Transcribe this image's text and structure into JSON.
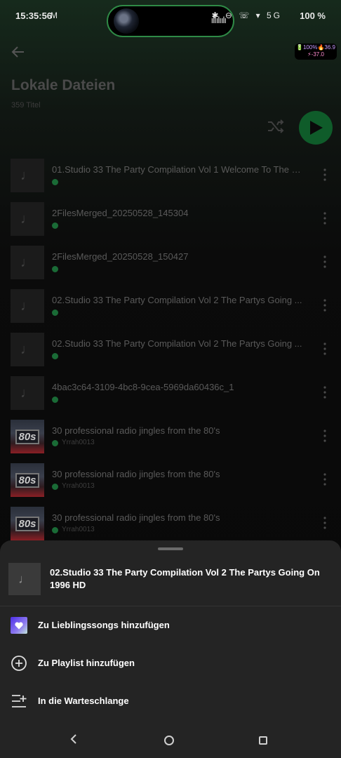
{
  "status": {
    "time": "15:35:56",
    "time_icon": "M",
    "wave": "ılıılıılı",
    "sys_icons": "✱ ⊖ ☏ ▾ 5G",
    "battery": "100 %",
    "badge_line1": "🔋100%🔥36.9",
    "badge_line2": "⚡-37.0"
  },
  "header": {
    "title": "Lokale Dateien",
    "subtitle": "359 Titel"
  },
  "tracks": [
    {
      "title": "01.Studio 33  The Party Compilation  Vol 1 Welcome To The So...",
      "artist": "",
      "art": "note"
    },
    {
      "title": "2FilesMerged_20250528_145304",
      "artist": "",
      "art": "note"
    },
    {
      "title": "2FilesMerged_20250528_150427",
      "artist": "",
      "art": "note"
    },
    {
      "title": "02.Studio 33  The Party Compilation  Vol 2 The Partys Going ...",
      "artist": "",
      "art": "note"
    },
    {
      "title": "02.Studio 33  The Party Compilation  Vol 2 The Partys Going ...",
      "artist": "",
      "art": "note"
    },
    {
      "title": "4bac3c64-3109-4bc8-9cea-5969da60436c_1",
      "artist": "",
      "art": "note"
    },
    {
      "title": "30 professional radio jingles from the 80's",
      "artist": "Yrrah0013",
      "art": "80s"
    },
    {
      "title": "30 professional radio jingles from the 80's",
      "artist": "Yrrah0013",
      "art": "80s"
    },
    {
      "title": "30 professional radio jingles from the 80's",
      "artist": "Yrrah0013",
      "art": "80s"
    }
  ],
  "art_labels": {
    "note": "♩",
    "eighties": "80s"
  },
  "sheet": {
    "title": "02.Studio 33  The Party Compilation  Vol 2 The Partys Going On 1996 HD",
    "actions": [
      {
        "label": "Zu Lieblingssongs hinzufügen",
        "icon": "liked-songs-icon"
      },
      {
        "label": "Zu Playlist hinzufügen",
        "icon": "add-circle-icon"
      },
      {
        "label": "In die Warteschlange",
        "icon": "queue-icon"
      }
    ]
  },
  "colors": {
    "accent": "#1db954",
    "sheet_bg": "#242424"
  }
}
